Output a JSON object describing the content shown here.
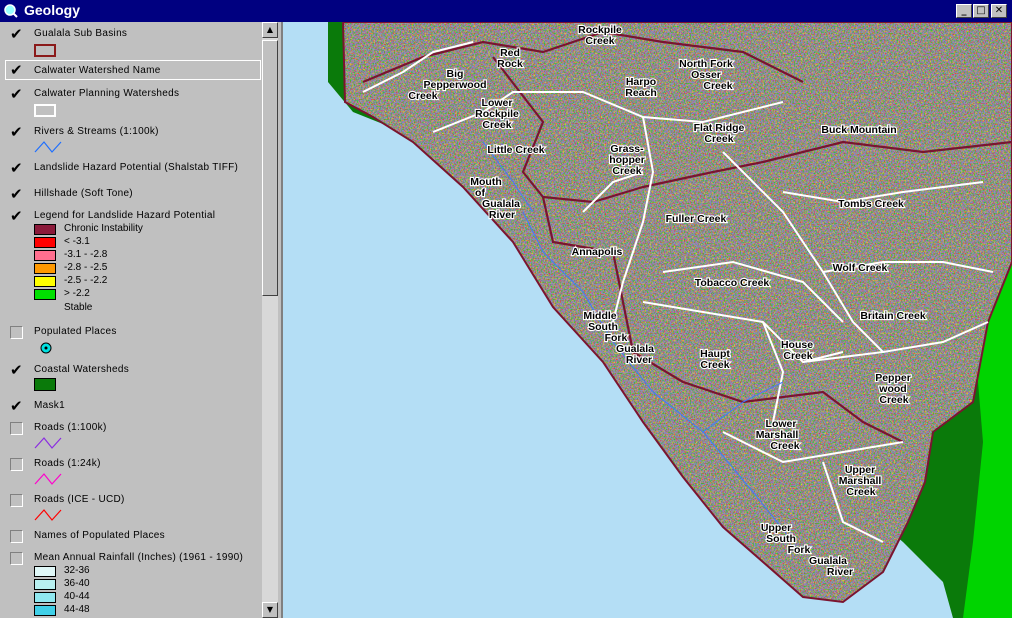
{
  "window": {
    "title": "Geology"
  },
  "toc": {
    "layers": [
      {
        "name": "Gualala Sub Basins",
        "checked": true
      },
      {
        "name": "Calwater Watershed Name",
        "checked": true
      },
      {
        "name": "Calwater Planning Watersheds",
        "checked": true
      },
      {
        "name": "Rivers & Streams (1:100k)",
        "checked": true
      },
      {
        "name": "Landslide Hazard Potential (Shalstab TIFF)",
        "checked": true
      },
      {
        "name": "Hillshade (Soft Tone)",
        "checked": true
      },
      {
        "name": "Legend for Landslide Hazard Potential",
        "checked": true
      },
      {
        "name": "Populated Places",
        "checked": false
      },
      {
        "name": "Coastal Watersheds",
        "checked": true
      },
      {
        "name": "Mask1",
        "checked": true
      },
      {
        "name": "Roads (1:100k)",
        "checked": false
      },
      {
        "name": "Roads (1:24k)",
        "checked": false
      },
      {
        "name": "Roads (ICE - UCD)",
        "checked": false
      },
      {
        "name": "Names of Populated Places",
        "checked": false
      },
      {
        "name": "Mean Annual Rainfall (Inches) (1961 - 1990)",
        "checked": false
      }
    ],
    "landslide_legend": [
      {
        "label": "Chronic Instability",
        "color": "#8b1a3a"
      },
      {
        "label": "<  -3.1",
        "color": "#ff0000"
      },
      {
        "label": "-3.1 - -2.8",
        "color": "#ff6f8f"
      },
      {
        "label": "-2.8 - -2.5",
        "color": "#ff9900"
      },
      {
        "label": "-2.5 - -2.2",
        "color": "#ffff00"
      },
      {
        "label": ">  -2.2",
        "color": "#00e000"
      },
      {
        "label": "Stable",
        "color": ""
      }
    ],
    "rainfall_legend": [
      {
        "label": "32-36",
        "color": "#e0f8f8"
      },
      {
        "label": "36-40",
        "color": "#b8f0f0"
      },
      {
        "label": "40-44",
        "color": "#90e8f0"
      },
      {
        "label": "44-48",
        "color": "#40d0e8"
      }
    ]
  },
  "map": {
    "labels": [
      {
        "lines": [
          "Rockpile",
          "Creek"
        ]
      },
      {
        "lines": [
          "Red",
          "Rock"
        ]
      },
      {
        "lines": [
          "Big",
          "Pepperwood",
          "Creek"
        ]
      },
      {
        "lines": [
          "Harpo",
          "Reach"
        ]
      },
      {
        "lines": [
          "North Fork",
          "Osser",
          "Creek"
        ]
      },
      {
        "lines": [
          "Lower",
          "Rockpile",
          "Creek"
        ]
      },
      {
        "lines": [
          "Flat Ridge",
          "Creek"
        ]
      },
      {
        "lines": [
          "Buck Mountain"
        ]
      },
      {
        "lines": [
          "Little Creek"
        ]
      },
      {
        "lines": [
          "Grass-",
          "hopper",
          "Creek"
        ]
      },
      {
        "lines": [
          "Mouth",
          "of",
          "Gualala",
          "River"
        ]
      },
      {
        "lines": [
          "Fuller Creek"
        ]
      },
      {
        "lines": [
          "Tombs Creek"
        ]
      },
      {
        "lines": [
          "Annapolis"
        ]
      },
      {
        "lines": [
          "Wolf Creek"
        ]
      },
      {
        "lines": [
          "Tobacco Creek"
        ]
      },
      {
        "lines": [
          "Britain Creek"
        ]
      },
      {
        "lines": [
          "Middle",
          "South",
          "Fork",
          "Gualala",
          "River"
        ]
      },
      {
        "lines": [
          "House",
          "Creek"
        ]
      },
      {
        "lines": [
          "Haupt",
          "Creek"
        ]
      },
      {
        "lines": [
          "Pepper",
          "wood",
          "Creek"
        ]
      },
      {
        "lines": [
          "Lower",
          "Marshall",
          "Creek"
        ]
      },
      {
        "lines": [
          "Upper",
          "Marshall",
          "Creek"
        ]
      },
      {
        "lines": [
          "Upper",
          "South",
          "Fork",
          "Gualala",
          "River"
        ]
      }
    ]
  }
}
